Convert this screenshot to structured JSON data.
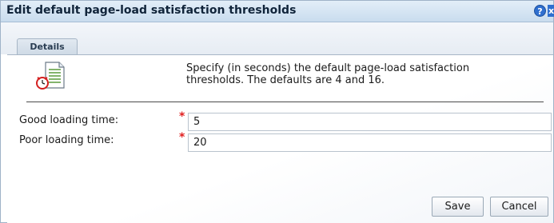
{
  "dialog": {
    "title": "Edit default page-load satisfaction thresholds",
    "help_glyph": "?",
    "close_glyph": "x"
  },
  "tabs": [
    {
      "label": "Details",
      "selected": true
    }
  ],
  "details": {
    "icon": "document-clock-icon",
    "description": "Specify (in seconds) the default page-load satisfaction\nthresholds. The defaults are 4 and 16."
  },
  "form": {
    "required_mark": "*",
    "fields": [
      {
        "label": "Good loading time:",
        "value": "5",
        "required": true
      },
      {
        "label": "Poor loading time:",
        "value": "20",
        "required": true
      }
    ]
  },
  "buttons": {
    "save_label": "Save",
    "cancel_label": "Cancel"
  },
  "colors": {
    "titlebar": "#c9dcee",
    "accent": "#2f6fcf",
    "required": "#e02020"
  }
}
